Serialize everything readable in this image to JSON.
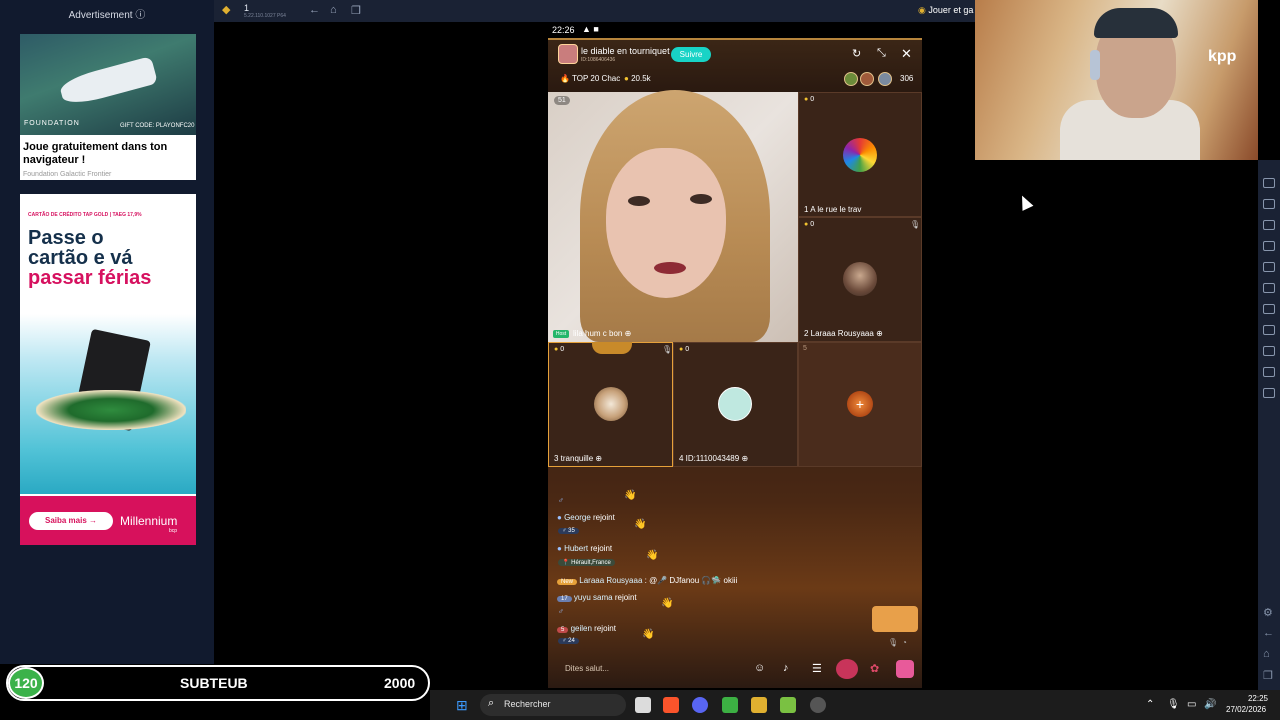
{
  "ad_sidebar": {
    "header": "Advertisement",
    "ad1": {
      "brand": "FOUNDATION",
      "code": "GIFT CODE: PLAYONFC20",
      "title": "Joue gratuitement dans ton navigateur !",
      "source": "Foundation Galactic Frontier"
    },
    "ad2": {
      "tag": "CARTÃO DE CRÉDITO TAP GOLD | TAEG 17,9%",
      "line1": "Passe o",
      "line2": "cartão e vá",
      "line3": "passar férias",
      "cta": "Saiba mais →",
      "bank": "Millennium",
      "bank_sub": "bcp"
    }
  },
  "emulator": {
    "title": "1",
    "version": "5.22.110.1027 P64",
    "play_link": "Jouer et ga"
  },
  "status_bar": {
    "time": "22:26",
    "icons": "▲ ■"
  },
  "room": {
    "name": "le diable en tourniquet",
    "id": "ID:1086406436",
    "follow_label": "Suivre",
    "top_rank": "TOP 20 Chac",
    "coins": "20.5k",
    "viewer_count": "306"
  },
  "seats": {
    "host": {
      "badge": "Host",
      "name": "lila hum c bon",
      "score": "51"
    },
    "s1": {
      "score": "0",
      "label": "1   A le rue le trav"
    },
    "s2": {
      "score": "0",
      "label": "2   Laraaa Rousyaaa"
    },
    "s3": {
      "score": "0",
      "label": "3   tranquille"
    },
    "s4": {
      "score": "0",
      "label": "4   ID:1110043489"
    },
    "s5": {
      "number": "5"
    }
  },
  "chat": [
    {
      "user": "George",
      "text": "rejoint",
      "badge": "35"
    },
    {
      "user": "Hubert",
      "text": "rejoint",
      "badge": "Hérault,France"
    },
    {
      "user": "Laraaa Rousyaaa",
      "text": ": @🎤 DJfanou 🎧🛸 okiii",
      "badge": "New"
    },
    {
      "user": "yuyu sama",
      "text": "rejoint",
      "badge": "17"
    },
    {
      "user": "geilen",
      "text": "rejoint",
      "badge": "5",
      "badge2": "24"
    }
  ],
  "chat_input_placeholder": "Dites salut...",
  "taskbar": {
    "search_label": "Rechercher",
    "time": "22:25",
    "date": "27/02/2026"
  },
  "sub_goal": {
    "current": "120",
    "label": "SUBTEUB",
    "goal": "2000"
  },
  "webcam": {
    "shirt_text": "kpp"
  },
  "colors": {
    "follow": "#18d3c6",
    "accent_gold": "#e6a13a",
    "sub_green": "#3bb24a",
    "ad_pink": "#d7115c"
  }
}
